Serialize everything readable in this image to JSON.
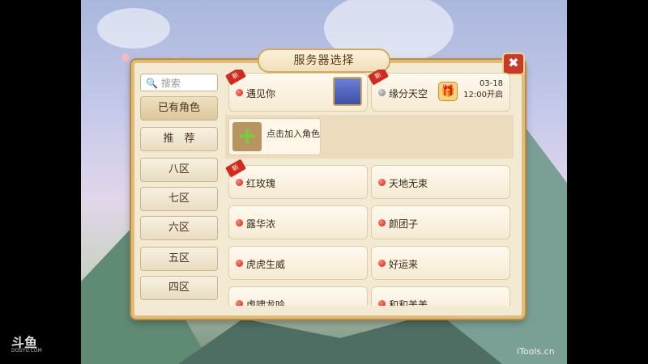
{
  "dialog": {
    "title": "服务器选择",
    "close_label": "✖"
  },
  "search": {
    "placeholder": "🔍 搜索"
  },
  "sidebar": {
    "items": [
      {
        "label": "已有角色"
      },
      {
        "label": "推　荐"
      },
      {
        "label": "八区"
      },
      {
        "label": "七区"
      },
      {
        "label": "六区"
      },
      {
        "label": "五区"
      },
      {
        "label": "四区"
      }
    ]
  },
  "recent": {
    "server1": {
      "name": "遇见你",
      "badge": "新"
    },
    "server2": {
      "name": "缘分天空",
      "badge": "新",
      "date": "03-18",
      "time": "12:00开启"
    }
  },
  "add_role": {
    "label": "点击加入角色",
    "icon": "+"
  },
  "servers": [
    {
      "name": "红玫瑰",
      "badge": "新"
    },
    {
      "name": "天地无束"
    },
    {
      "name": "露华浓"
    },
    {
      "name": "颜团子"
    },
    {
      "name": "虎虎生威"
    },
    {
      "name": "好运来"
    },
    {
      "name": "虎啸龙吟"
    },
    {
      "name": "和和美美"
    }
  ],
  "watermarks": {
    "left_logo": "斗鱼",
    "left_sub": "DOUYU.COM",
    "right": "iTools.cn"
  }
}
